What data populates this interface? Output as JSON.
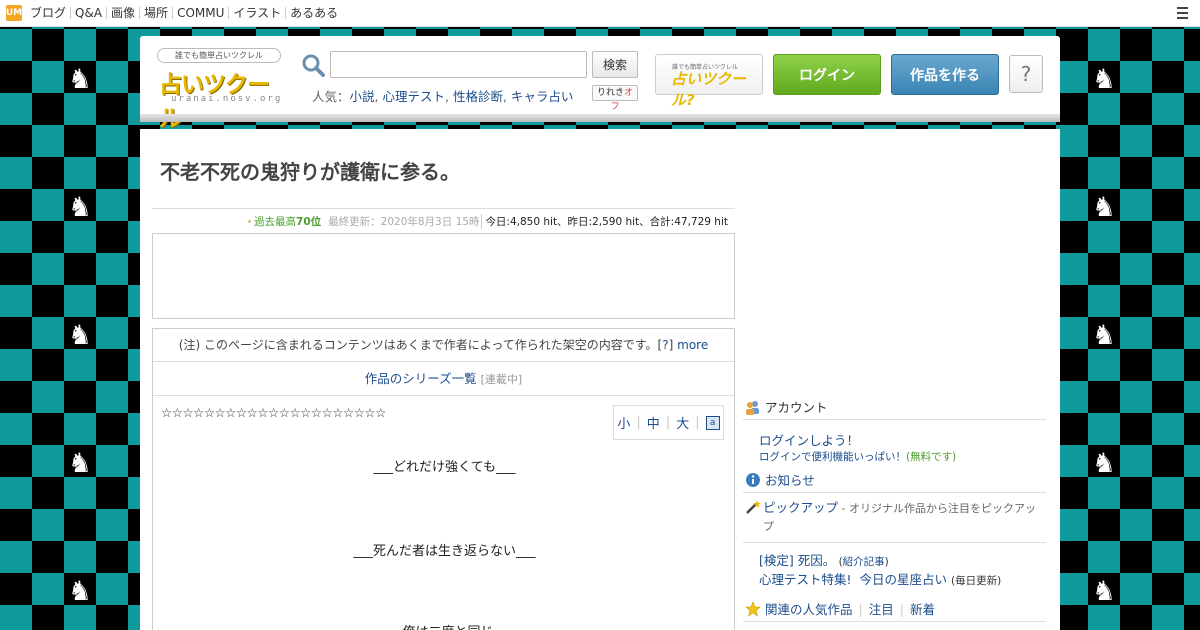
{
  "topbar": {
    "logo": "UM",
    "items": [
      "ブログ",
      "Q&A",
      "画像",
      "場所",
      "COMMU",
      "イラスト",
      "あるある"
    ]
  },
  "header": {
    "logo_tagline": "誰でも簡単占いツクレル",
    "logo_text": "占いツクール",
    "logo_url": "uranai.nosv.org",
    "search_placeholder": "",
    "search_button": "検索",
    "popular_label": "人気：",
    "popular_links": [
      "小説",
      "心理テスト",
      "性格診断",
      "キャラ占い"
    ],
    "rireki_label": "りれき",
    "rireki_state": "オフ",
    "about_small": "誰でも簡単占いツクレル",
    "about_main": "占いツクール?",
    "login_button": "ログイン",
    "create_button": "作品を作る",
    "help_button": "?"
  },
  "article": {
    "title": "不老不死の鬼狩りが護衛に参る。",
    "best_rank_prefix": "過去最高",
    "best_rank": "70位",
    "last_update": "最終更新：2020年8月3日 15時",
    "hits": "今日:4,850 hit、昨日:2,590 hit、合計:47,729 hit",
    "notice": "(注) このページに含まれるコンテンツはあくまで作者によって作られた架空の内容です。[",
    "notice_q": "?",
    "notice_end": "]",
    "notice_more": "more",
    "series_link": "作品のシリーズ一覧",
    "series_status": "[連載中]",
    "stars": "☆☆☆☆☆☆☆☆☆☆☆☆☆☆☆☆☆☆☆☆☆",
    "font_small": "小",
    "font_medium": "中",
    "font_large": "大",
    "tts_icon": "a",
    "line1": "___どれだけ強くても___",
    "line2": "___死んだ者は生き返らない___",
    "line3": "___俺は二度と同じ..."
  },
  "sidebar": {
    "account_head": "アカウント",
    "account_link": "ログインしよう！",
    "account_sub": "ログインで便利機能いっぱい！",
    "account_free": "(無料です)",
    "news_head": "お知らせ",
    "pickup_head": "ピックアップ",
    "pickup_desc": " - オリジナル作品から注目をピックアップ",
    "pickup_link1": "[検定] 死因。",
    "pickup_link1_note_open": " (",
    "pickup_link1_note": "紹介記事",
    "pickup_link1_note_close": ")",
    "pickup_link2": "心理テスト特集!",
    "pickup_link3": "今日の星座占い",
    "pickup_link3_note": "(毎日更新)",
    "popular_head": "関連の人気作品",
    "popular_tab1": "注目",
    "popular_tab2": "新着"
  },
  "colors": {
    "checker_teal": "#119a9b",
    "checker_black": "#000000",
    "login_green": "#62a91e",
    "create_blue": "#3a84b3",
    "link_blue": "#1c4c8c",
    "rank_green": "#4a9d2b"
  }
}
